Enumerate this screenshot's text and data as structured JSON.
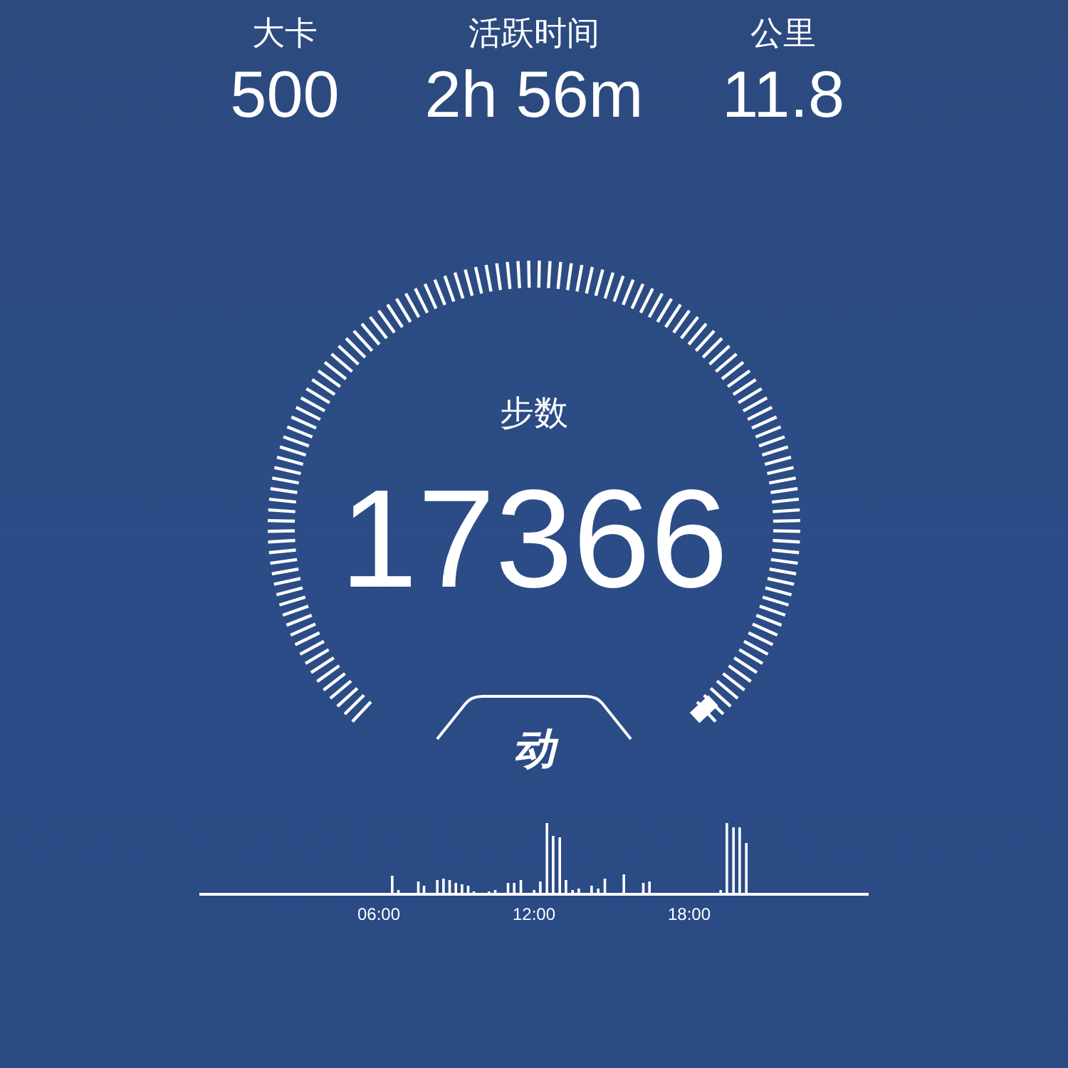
{
  "stats": [
    {
      "label": "大卡",
      "value": "500"
    },
    {
      "label": "活跃时间",
      "value": "2h 56m"
    },
    {
      "label": "公里",
      "value": "11.8"
    }
  ],
  "gauge": {
    "label": "步数",
    "value": "17366"
  },
  "logo": {
    "text": "动"
  },
  "activity_chart": {
    "time_labels": [
      "06:00",
      "12:00",
      "18:00"
    ]
  }
}
